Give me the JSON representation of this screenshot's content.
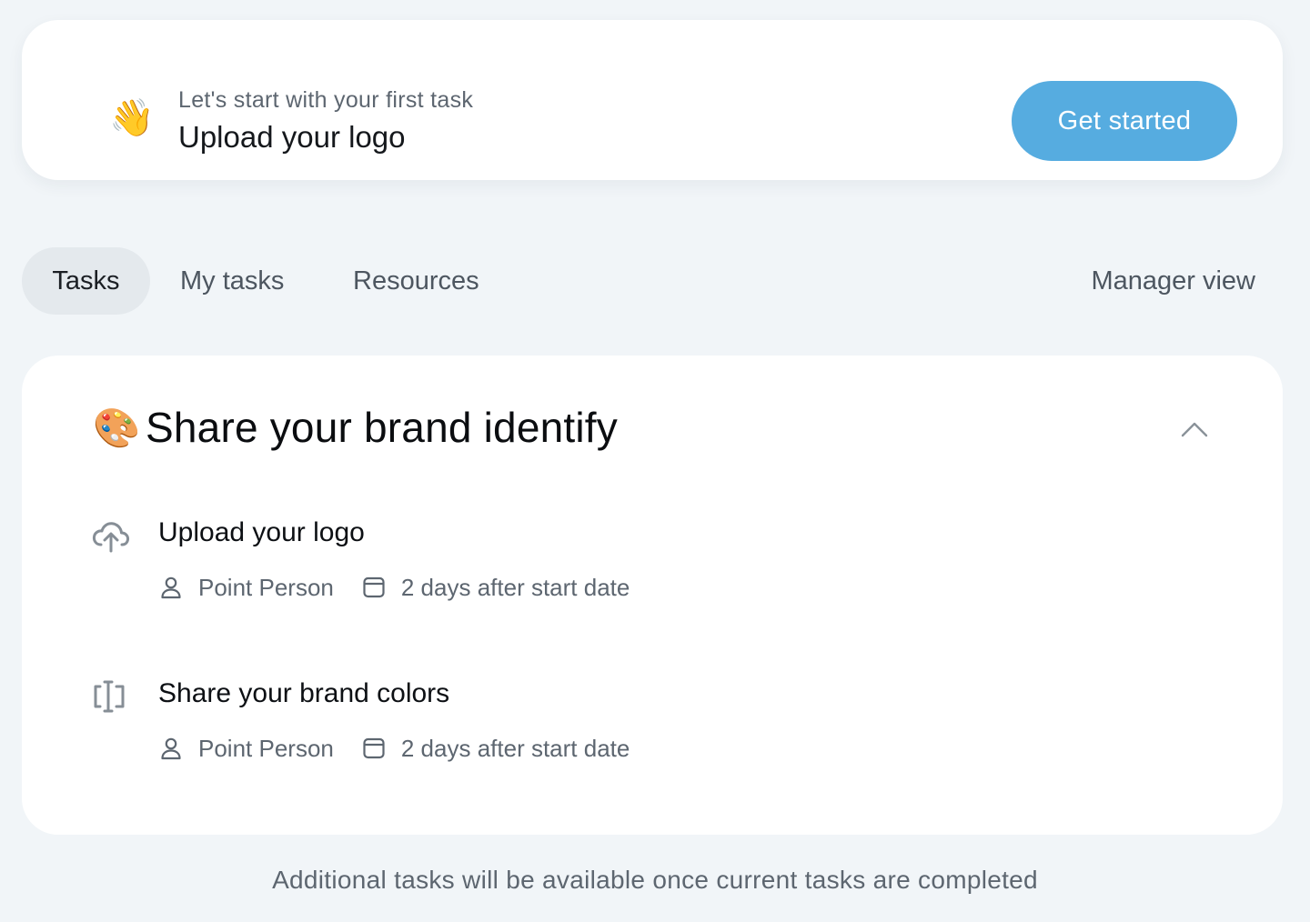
{
  "banner": {
    "emoji": "👋",
    "subtitle": "Let's start with your first task",
    "title": "Upload your logo",
    "cta_label": "Get started"
  },
  "tabs": {
    "items": [
      {
        "label": "Tasks",
        "active": true
      },
      {
        "label": "My tasks",
        "active": false
      },
      {
        "label": "Resources",
        "active": false
      }
    ],
    "right_label": "Manager view"
  },
  "section": {
    "emoji": "🎨",
    "title": "Share your brand identify",
    "collapse_icon": "chevron-up-icon",
    "tasks": [
      {
        "icon": "cloud-upload-icon",
        "title": "Upload your logo",
        "assignee": "Point Person",
        "due": "2 days after start date"
      },
      {
        "icon": "text-cursor-icon",
        "title": "Share your brand colors",
        "assignee": "Point Person",
        "due": "2 days after start date"
      }
    ]
  },
  "footer": {
    "note": "Additional tasks will be available once current tasks are completed"
  },
  "colors": {
    "accent": "#56ace0",
    "background": "#f1f5f8",
    "active_tab": "#e4e9ed",
    "muted_text": "#5d6670"
  }
}
